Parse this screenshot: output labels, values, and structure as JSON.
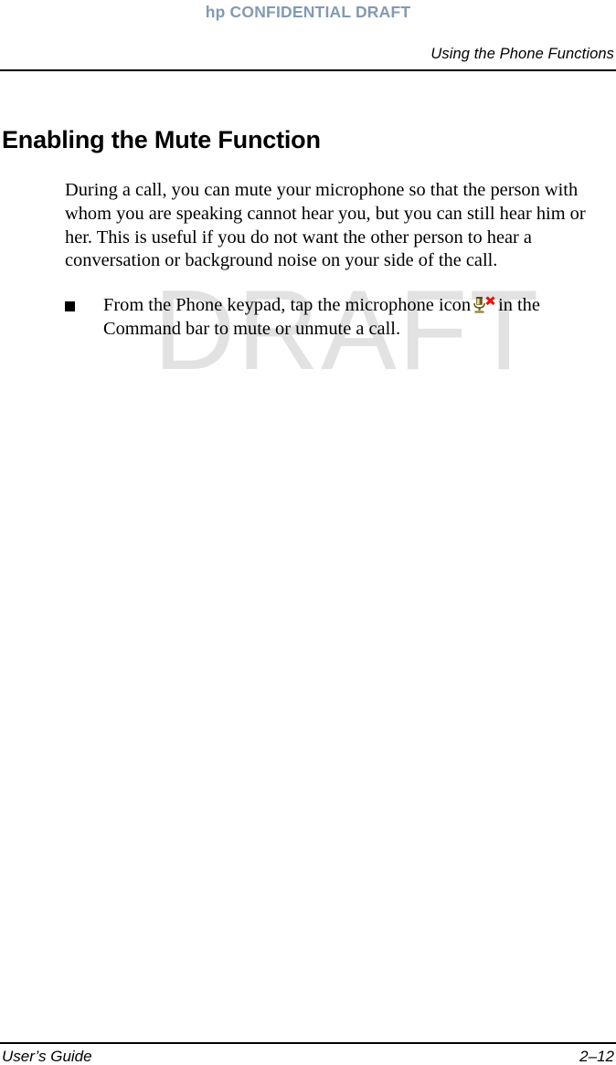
{
  "header": {
    "confidential_banner": "hp CONFIDENTIAL DRAFT",
    "running_head": "Using the Phone Functions",
    "banner_color": "#8399b4"
  },
  "watermark": {
    "text": "DRAFT",
    "color": "#e2e2e2"
  },
  "main": {
    "heading": "Enabling the Mute Function",
    "paragraph": "During a call, you can mute your microphone so that the person with whom you are speaking cannot hear you, but you can still hear him or her. This is useful if you do not want the other person to hear a conversation or background noise on your side of the call.",
    "bullets": [
      {
        "marker": "square-bullet",
        "text_before_icon": "From the Phone keypad, tap the microphone icon",
        "icon": "microphone-mute-icon",
        "text_after_icon": "in the Command bar to mute or unmute a call."
      }
    ]
  },
  "icon_colors": {
    "microphone_body": "#8a7a3c",
    "microphone_highlight": "#e8d98a",
    "microphone_dark": "#554a22",
    "cancel_mark": "#ee1111"
  },
  "footer": {
    "left": "User’s Guide",
    "right": "2–12"
  }
}
